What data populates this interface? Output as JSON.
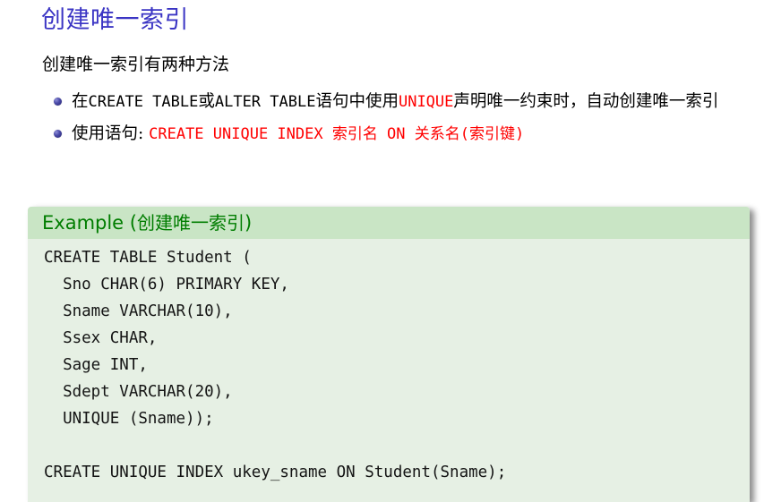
{
  "slide": {
    "title": "创建唯一索引",
    "intro": "创建唯一索引有两种方法",
    "bullets": [
      {
        "id": "bullet-unique-constraint",
        "segments": [
          {
            "text": "在",
            "style": "cn"
          },
          {
            "text": "CREATE TABLE",
            "style": "mono"
          },
          {
            "text": "或",
            "style": "cn"
          },
          {
            "text": "ALTER TABLE",
            "style": "mono"
          },
          {
            "text": "语句中使用",
            "style": "cn"
          },
          {
            "text": "UNIQUE",
            "style": "mono-red"
          },
          {
            "text": "声明唯一约束时，自动创建唯一索引",
            "style": "cn"
          }
        ],
        "plain": "在CREATE TABLE或ALTER TABLE语句中使用UNIQUE声明唯一约束时，自动创建唯一索引"
      },
      {
        "id": "bullet-create-index-syntax",
        "segments": [
          {
            "text": "使用语句: ",
            "style": "cn"
          },
          {
            "text": "CREATE UNIQUE INDEX 索引名 ON 关系名(索引键)",
            "style": "mono-red"
          }
        ],
        "plain": "使用语句: CREATE UNIQUE INDEX 索引名 ON 关系名(索引键)"
      }
    ]
  },
  "example_block": {
    "header_label": "Example",
    "header_paren_open": " (",
    "header_title": "创建唯一索引",
    "header_paren_close": ")",
    "code_lines": [
      "CREATE TABLE Student (",
      "  Sno CHAR(6) PRIMARY KEY,",
      "  Sname VARCHAR(10),",
      "  Ssex CHAR,",
      "  Sage INT,",
      "  Sdept VARCHAR(20),",
      "  UNIQUE (Sname));",
      "",
      "CREATE UNIQUE INDEX ukey_sname ON Student(Sname);"
    ]
  },
  "colors": {
    "title": "#3b35c4",
    "keyword_red": "#ff0000",
    "block_header_bg": "#c9e5c5",
    "block_body_bg": "#e6f0e4",
    "block_header_text": "#007d00",
    "bullet_dot": "#26246e",
    "body_text": "#000000",
    "page_bg": "#ffffff"
  }
}
